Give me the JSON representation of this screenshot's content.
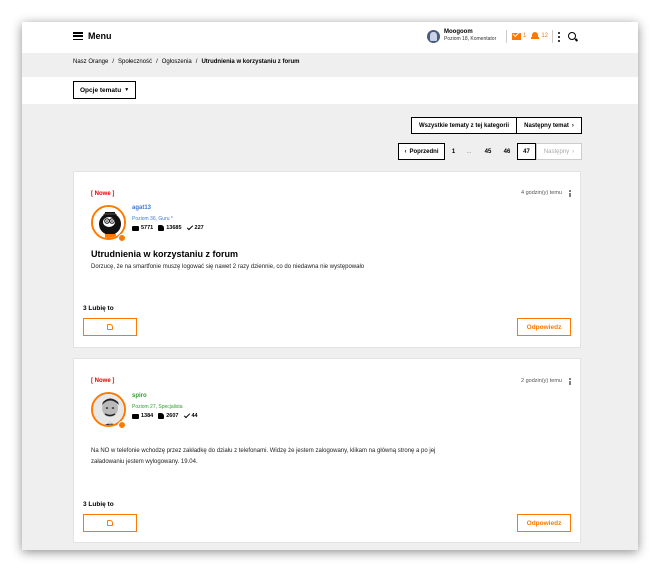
{
  "header": {
    "menu_label": "Menu",
    "user_name": "Moogoom",
    "user_rank": "Poziom 18, Komentator",
    "mail_count": "1",
    "notif_count": "12"
  },
  "breadcrumb": {
    "items": [
      "Nasz Orange",
      "Społeczność",
      "Ogłoszenia"
    ],
    "current": "Utrudnienia w korzystaniu z forum"
  },
  "options": {
    "label": "Opcje tematu"
  },
  "nav": {
    "all_topics": "Wszystkie tematy z tej kategorii",
    "next_topic": "Następny temat"
  },
  "pagination": {
    "prev": "Poprzedni",
    "pages": [
      "1",
      "...",
      "45",
      "46",
      "47"
    ],
    "current": "47",
    "next": "Następny"
  },
  "posts": [
    {
      "tag": "[ Nowe ]",
      "time": "4 godzin(y) temu",
      "author": "agat13",
      "rank": "Poziom 36, Guru *",
      "stats": {
        "messages": "5771",
        "likes": "13685",
        "solutions": "227"
      },
      "title": "Utrudnienia w korzystaniu z forum",
      "body": "Dorzucę, że na smartfonie muszę logować się nawet 2 razy dziennie, co do niedawna nie występowało",
      "likes_label": "3 Lubię to",
      "reply_label": "Odpowiedz"
    },
    {
      "tag": "[ Nowe ]",
      "time": "2 godzin(y) temu",
      "author": "spiro",
      "rank": "Poziom 27, Specjalista",
      "stats": {
        "messages": "1384",
        "likes": "2607",
        "solutions": "44"
      },
      "body": "Na NO w telefonie wchodzę przez zakładkę do działu z telefonami. Widzę że jestem zalogowany, klikam na główną stronę a po jej załadowaniu jestem wylogowany. 19.04.",
      "likes_label": "3 Lubię to",
      "reply_label": "Odpowiedz"
    }
  ],
  "colors": {
    "accent": "#ff7900",
    "new_tag": "#e60000",
    "author1": "#3c78d8",
    "author2": "#2e9e2e"
  }
}
